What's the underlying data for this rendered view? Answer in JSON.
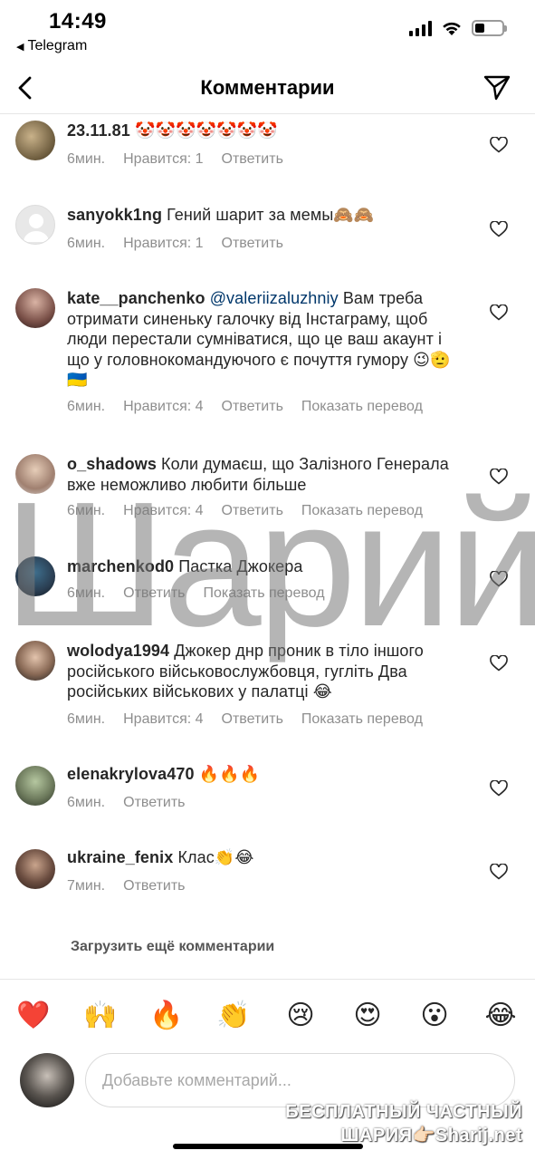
{
  "status_bar": {
    "time": "14:49",
    "back_app": "Telegram"
  },
  "header": {
    "title": "Комментарии"
  },
  "comments": [
    {
      "username": "23.11.81",
      "mention": "",
      "text": "🤡🤡🤡🤡🤡🤡🤡",
      "time": "6мин.",
      "likes": "Нравится: 1",
      "action1": "Ответить",
      "action2": ""
    },
    {
      "username": "sanyokk1ng",
      "mention": "",
      "text": "Гений шарит за мемы🙈🙈",
      "time": "6мин.",
      "likes": "Нравится: 1",
      "action1": "Ответить",
      "action2": ""
    },
    {
      "username": "kate__panchenko",
      "mention": "@valeriizaluzhniy",
      "text": "Вам треба отримати синеньку галочку від Інстаграму, щоб люди перестали сумніватися, що це ваш акаунт і що у головнокомандуючого є почуття гумору 😉🫡🇺🇦",
      "time": "6мин.",
      "likes": "Нравится: 4",
      "action1": "Ответить",
      "action2": "Показать перевод"
    },
    {
      "username": "o_shadows",
      "mention": "",
      "text": "Коли думаєш, що Залізного Генерала вже неможливо любити більше",
      "time": "6мин.",
      "likes": "Нравится: 4",
      "action1": "Ответить",
      "action2": "Показать перевод"
    },
    {
      "username": "marchenkod0",
      "mention": "",
      "text": "Пастка Джокера",
      "time": "6мин.",
      "likes": "",
      "action1": "Ответить",
      "action2": "Показать перевод"
    },
    {
      "username": "wolodya1994",
      "mention": "",
      "text": "Джокер днр проник в тіло іншого російського військовослужбовця, гугліть Два російських військових у палатці 😂",
      "time": "6мин.",
      "likes": "Нравится: 4",
      "action1": "Ответить",
      "action2": "Показать перевод"
    },
    {
      "username": "elenakrylova470",
      "mention": "",
      "text": "🔥🔥🔥",
      "time": "6мин.",
      "likes": "",
      "action1": "Ответить",
      "action2": ""
    },
    {
      "username": "ukraine_fenix",
      "mention": "",
      "text": "Клас👏😂",
      "time": "7мин.",
      "likes": "",
      "action1": "Ответить",
      "action2": ""
    }
  ],
  "load_more": "Загрузить ещё комментарии",
  "emoji_bar": [
    "❤️",
    "🙌",
    "🔥",
    "👏",
    "😢",
    "😍",
    "😮",
    "😂"
  ],
  "input": {
    "placeholder": "Добавьте комментарий..."
  },
  "watermark": "Шарий",
  "brand": {
    "line1": "БЕСПЛАТНЫЙ ЧАСТНЫЙ",
    "line2": "ШАРИЯ👉🏻Sharij.net"
  },
  "colors": {
    "text": "#262626",
    "muted": "#8e8e8e",
    "mention": "#00376b",
    "divider": "#e6e6e6"
  }
}
